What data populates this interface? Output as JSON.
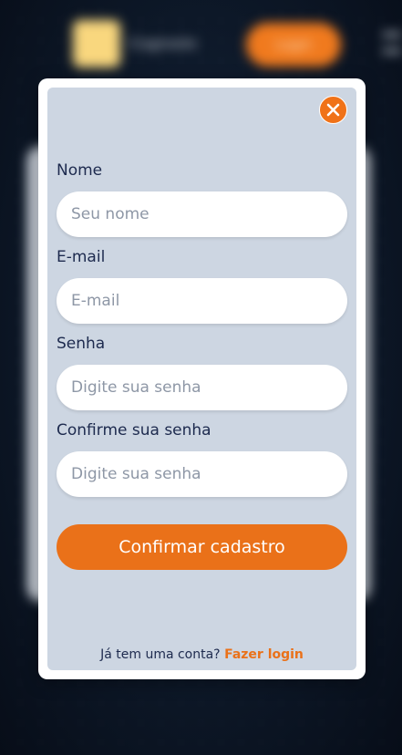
{
  "background": {
    "logo_text": "Cognoslo",
    "login_button_label": "Login"
  },
  "modal": {
    "close_icon": "close-icon",
    "fields": [
      {
        "label": "Nome",
        "placeholder": "Seu nome",
        "value": ""
      },
      {
        "label": "E-mail",
        "placeholder": "E-mail",
        "value": ""
      },
      {
        "label": "Senha",
        "placeholder": "Digite sua senha",
        "value": ""
      },
      {
        "label": "Confirme sua senha",
        "placeholder": "Digite sua senha",
        "value": ""
      }
    ],
    "submit_label": "Confirmar cadastro",
    "footer_text": "Já tem uma conta?",
    "footer_link": "Fazer login"
  },
  "colors": {
    "accent": "#ea7119",
    "modal_background": "#cdd6e2",
    "text": "#1d2a4e",
    "page_background": "#0d1828"
  }
}
